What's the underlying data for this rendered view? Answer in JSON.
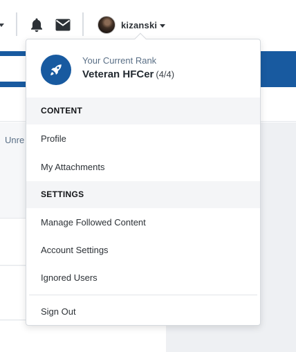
{
  "header": {
    "username": "kizanski"
  },
  "background": {
    "unread_label": "Unre"
  },
  "account_menu": {
    "rank": {
      "caption": "Your Current Rank",
      "name": "Veteran HFCer",
      "level": "(4/4)"
    },
    "sections": [
      {
        "heading": "CONTENT",
        "items": [
          {
            "label": "Profile"
          },
          {
            "label": "My Attachments"
          }
        ]
      },
      {
        "heading": "SETTINGS",
        "items": [
          {
            "label": "Manage Followed Content"
          },
          {
            "label": "Account Settings"
          },
          {
            "label": "Ignored Users"
          }
        ]
      }
    ],
    "sign_out_label": "Sign Out"
  },
  "colors": {
    "brand_blue": "#185aa0",
    "text_dark": "#232a31",
    "muted_blue_gray": "#5a6f86"
  },
  "icons": {
    "notifications": "bell-icon",
    "messages": "envelope-icon",
    "rank": "rocket-icon"
  }
}
